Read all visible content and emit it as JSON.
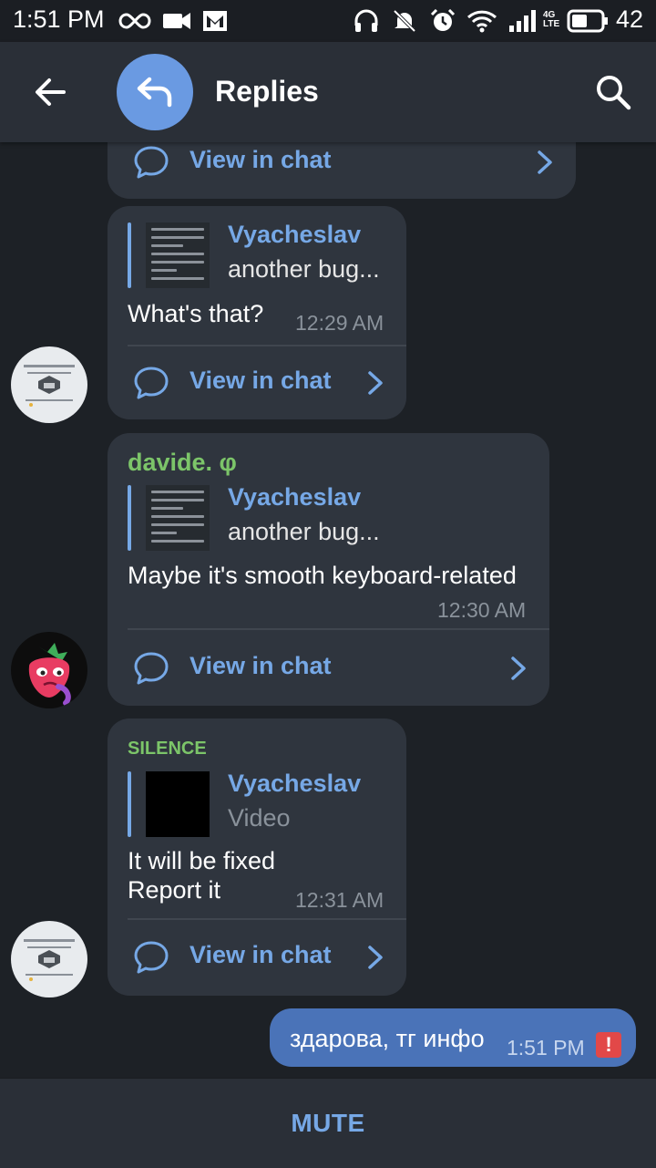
{
  "status_bar": {
    "time": "1:51 PM",
    "battery": "42",
    "network": "4G LTE",
    "icons": [
      "infinity-icon",
      "video-icon",
      "gmail-icon",
      "headphones-icon",
      "notifications-off-icon",
      "alarm-icon",
      "wifi-icon",
      "signal-icon",
      "battery-icon"
    ]
  },
  "header": {
    "title": "Replies",
    "icons": [
      "back-arrow-icon",
      "reply-icon",
      "search-icon"
    ],
    "avatar_color": "#6a9ae2"
  },
  "messages": [
    {
      "view_in_chat": "View in chat"
    },
    {
      "quote_name": "Vyacheslav",
      "quote_text": "another bug...",
      "text": "What's that?",
      "time": "12:29 AM",
      "view_in_chat": "View in chat"
    },
    {
      "sender": "davide. φ",
      "quote_name": "Vyacheslav",
      "quote_text": "another bug...",
      "text": "Maybe it's smooth keyboard-related",
      "time": "12:30 AM",
      "view_in_chat": "View in chat"
    },
    {
      "sender": "SILENCE",
      "quote_name": "Vyacheslav",
      "quote_text": "Video",
      "text_line1": "It will be fixed",
      "text_line2": "Report it",
      "time": "12:31 AM",
      "view_in_chat": "View in chat"
    }
  ],
  "outgoing": {
    "text": "здарова, тг инфо",
    "time": "1:51 PM",
    "status": "!"
  },
  "bottom": {
    "mute_label": "MUTE"
  },
  "colors": {
    "accent": "#76a8e6",
    "sender_green": "#7cc569",
    "bubble": "#2f353e",
    "outgoing": "#4a73b8",
    "error": "#e24848"
  }
}
